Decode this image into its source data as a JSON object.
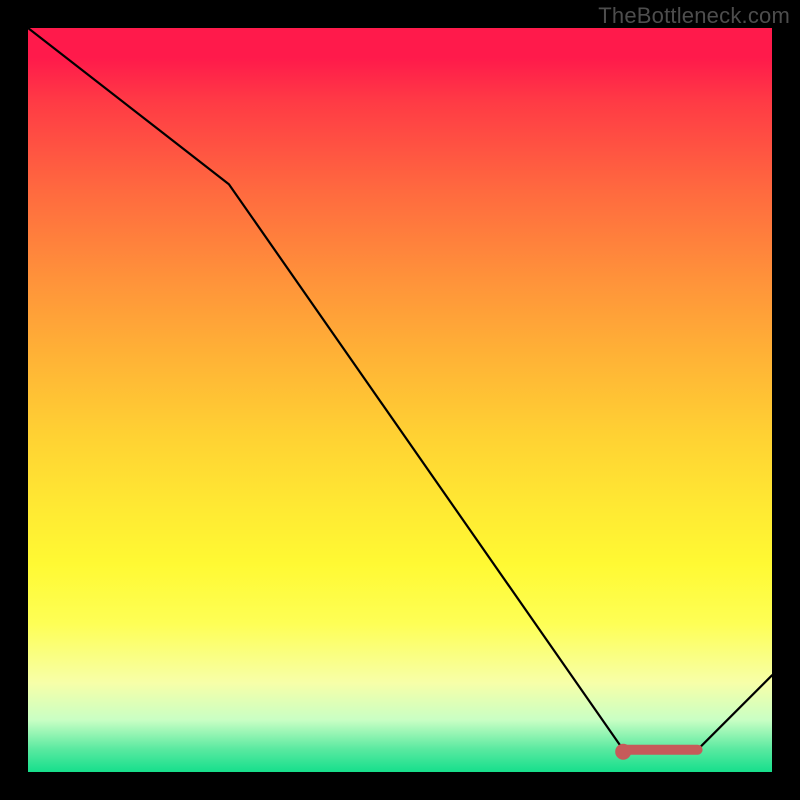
{
  "watermark": "TheBottleneck.com",
  "colors": {
    "frame": "#000000",
    "curve": "#000000",
    "marker": "#c65b5a",
    "gradient_top": "#ff1a4b",
    "gradient_bottom": "#16df8c"
  },
  "chart_data": {
    "type": "line",
    "title": "",
    "xlabel": "",
    "ylabel": "",
    "xlim": [
      0,
      100
    ],
    "ylim": [
      0,
      100
    ],
    "grid": false,
    "legend": false,
    "series": [
      {
        "name": "curve",
        "x": [
          0,
          27,
          80,
          90,
          100
        ],
        "values": [
          100,
          79,
          3,
          3,
          13
        ]
      }
    ],
    "highlight": {
      "name": "optimal-zone",
      "x_range": [
        80,
        90
      ],
      "y": 3
    }
  }
}
